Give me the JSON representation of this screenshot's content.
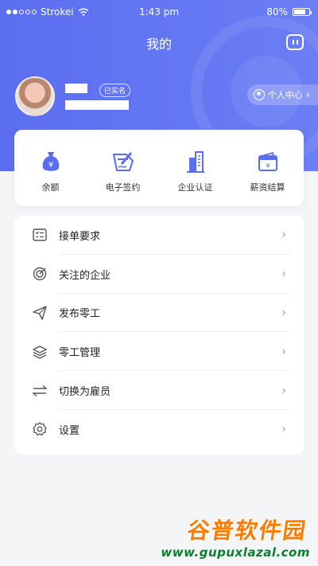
{
  "status_bar": {
    "carrier": "Strokei",
    "time": "1:43 pm",
    "battery": "80%",
    "battery_level": 0.8
  },
  "header": {
    "title": "我的",
    "message_icon": "message-icon"
  },
  "profile": {
    "badge": "已实名",
    "personal_center": "个人中心"
  },
  "quick_actions": [
    {
      "label": "余额",
      "icon": "money-bag-icon"
    },
    {
      "label": "电子签约",
      "icon": "e-sign-icon"
    },
    {
      "label": "企业认证",
      "icon": "building-icon"
    },
    {
      "label": "薪资结算",
      "icon": "wallet-icon"
    }
  ],
  "menu": [
    {
      "label": "接单要求",
      "icon": "checklist-icon"
    },
    {
      "label": "关注的企业",
      "icon": "target-icon"
    },
    {
      "label": "发布零工",
      "icon": "paper-plane-icon"
    },
    {
      "label": "零工管理",
      "icon": "layers-icon"
    },
    {
      "label": "切换为雇员",
      "icon": "switch-icon"
    },
    {
      "label": "设置",
      "icon": "gear-icon"
    }
  ],
  "watermark": {
    "title": "谷普软件园",
    "url": "www.gupuxlazal.com"
  },
  "colors": {
    "primary": "#5b6ef0",
    "icon_blue": "#5b6ef0",
    "background": "#f4f5f7"
  }
}
